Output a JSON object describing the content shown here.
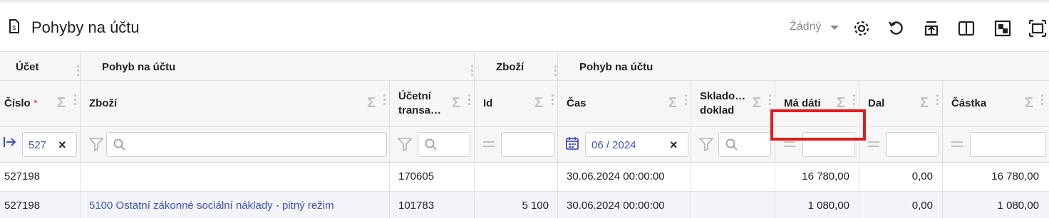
{
  "window": {
    "title": "Pohyby na účtu",
    "view_select": "Žádný",
    "icons": [
      "receipt-icon",
      "settings-gear-icon",
      "undo-reset-icon",
      "export-upload-icon",
      "split-columns-icon",
      "frame-icon",
      "fullscreen-icon"
    ]
  },
  "grid": {
    "groups": [
      "Účet",
      "Pohyb na účtu",
      "Zboží",
      "Pohyb na účtu"
    ],
    "columns": [
      "Číslo",
      "Zboží",
      "Účetní transa…",
      "Id",
      "Čas",
      "Sklado… doklad",
      "Má dáti",
      "Dal",
      "Částka"
    ],
    "required_mark": "*",
    "sigma": "Σ",
    "filters": {
      "cislo": "527",
      "cas": "06 / 2024",
      "clear": "×"
    },
    "rows": [
      {
        "cislo": "527198",
        "zbozi": "",
        "ucetni_transakce": "170605",
        "id": "",
        "cas": "30.06.2024 00:00:00",
        "skladovy_doklad": "",
        "ma_dati": "16 780,00",
        "dal": "0,00",
        "castka": "16 780,00"
      },
      {
        "cislo": "527198",
        "zbozi": "5100 Ostatní zákonné sociální náklady - pitný režim",
        "ucetni_transakce": "101783",
        "id": "5 100",
        "cas": "30.06.2024 00:00:00",
        "skladovy_doklad": "",
        "ma_dati": "1 080,00",
        "dal": "0,00",
        "castka": "1 080,00"
      }
    ]
  },
  "colors": {
    "accent": "#3f51b5",
    "highlight": "#e31b1b",
    "header_bg": "#f6f6f6",
    "row_alt": "#f3f4fa"
  }
}
